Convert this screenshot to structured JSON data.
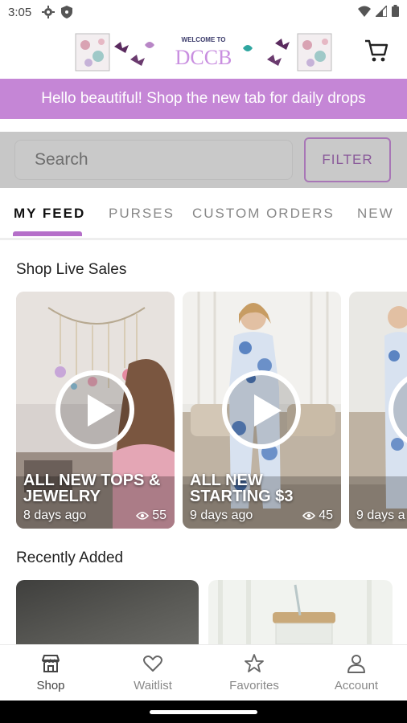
{
  "status_bar": {
    "time": "3:05"
  },
  "header": {
    "logo_welcome": "WELCOME TO",
    "logo_name": "DCCB"
  },
  "promo": {
    "text": "Hello beautiful! Shop the new tab for daily drops"
  },
  "search": {
    "placeholder": "Search",
    "filter_label": "FILTER"
  },
  "tabs": [
    {
      "label": "MY FEED",
      "active": true
    },
    {
      "label": "PURSES",
      "active": false
    },
    {
      "label": "CUSTOM ORDERS",
      "active": false
    },
    {
      "label": "NEW",
      "active": false
    }
  ],
  "live_sales": {
    "title": "Shop Live Sales",
    "cards": [
      {
        "title": "ALL NEW TOPS & JEWELRY",
        "time": "8 days ago",
        "views": "55"
      },
      {
        "title": "ALL NEW STARTING $3",
        "time": "9 days ago",
        "views": "45"
      },
      {
        "title": "",
        "time": "9 days a",
        "views": ""
      }
    ]
  },
  "recently_added": {
    "title": "Recently Added"
  },
  "bottom_nav": [
    {
      "label": "Shop",
      "icon": "store-icon",
      "active": true
    },
    {
      "label": "Waitlist",
      "icon": "heart-icon",
      "active": false
    },
    {
      "label": "Favorites",
      "icon": "star-icon",
      "active": false
    },
    {
      "label": "Account",
      "icon": "person-icon",
      "active": false
    }
  ],
  "colors": {
    "accent": "#c586d6",
    "indicator": "#b56fc9",
    "filter_border": "#a876b6"
  }
}
